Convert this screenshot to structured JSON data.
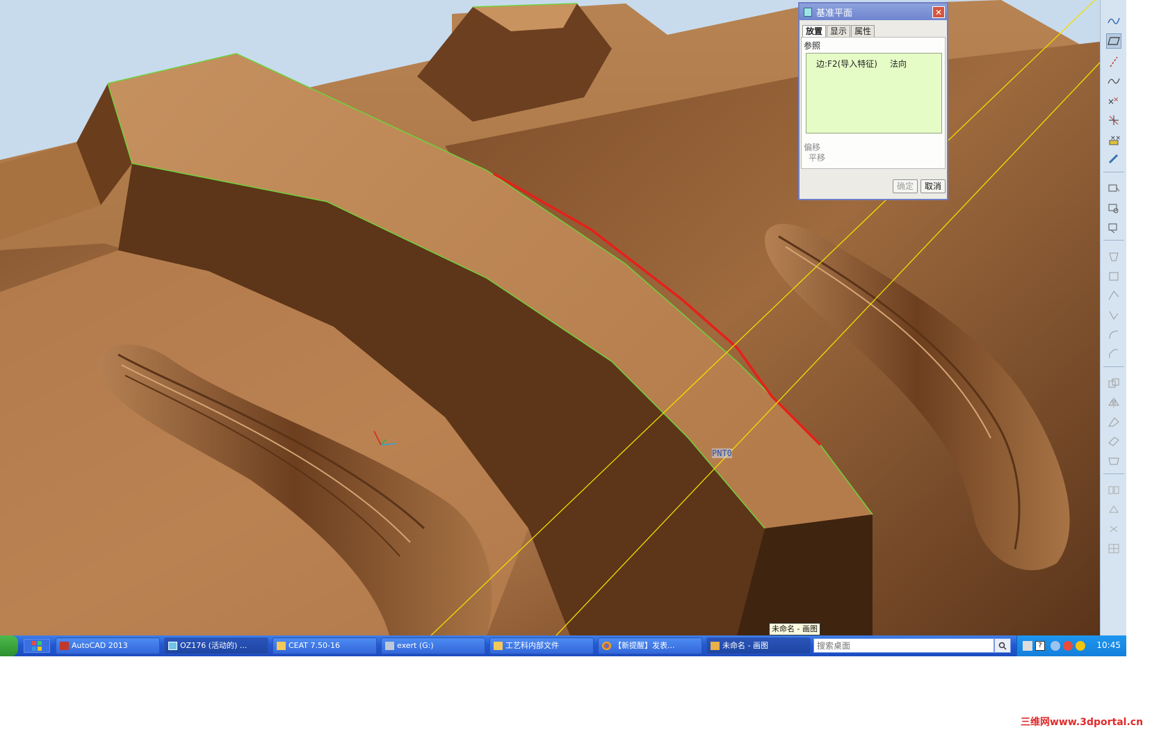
{
  "dialog": {
    "title": "基准平面",
    "tabs": [
      {
        "label": "放置"
      },
      {
        "label": "显示"
      },
      {
        "label": "属性"
      }
    ],
    "references_label": "参照",
    "reference_entry": "边:F2(导入特征)",
    "reference_direction": "法向",
    "offset_label": "偏移",
    "translate_label": "平移",
    "ok_label": "确定",
    "cancel_label": "取消"
  },
  "viewport": {
    "point_label": "PNT0",
    "tooltip": "未命名 - 画图"
  },
  "taskbar": {
    "items": [
      {
        "label": "AutoCAD 2013"
      },
      {
        "label": "OZ176 (活动的) ..."
      },
      {
        "label": "CEAT 7.50-16"
      },
      {
        "label": "exert (G:)"
      },
      {
        "label": "工艺科内部文件"
      },
      {
        "label": "【新提醒】发表..."
      },
      {
        "label": "未命名 - 画图"
      }
    ],
    "search_placeholder": "搜索桌面",
    "clock": "10:45"
  },
  "watermark": "三维网www.3dportal.cn",
  "colors": {
    "model_surface": "#c48d5d",
    "selected_edge": "#e6201a",
    "highlight_edge": "#6fd13c",
    "datum_plane": "#f0e000",
    "reference_box": "#e6fcc7"
  }
}
